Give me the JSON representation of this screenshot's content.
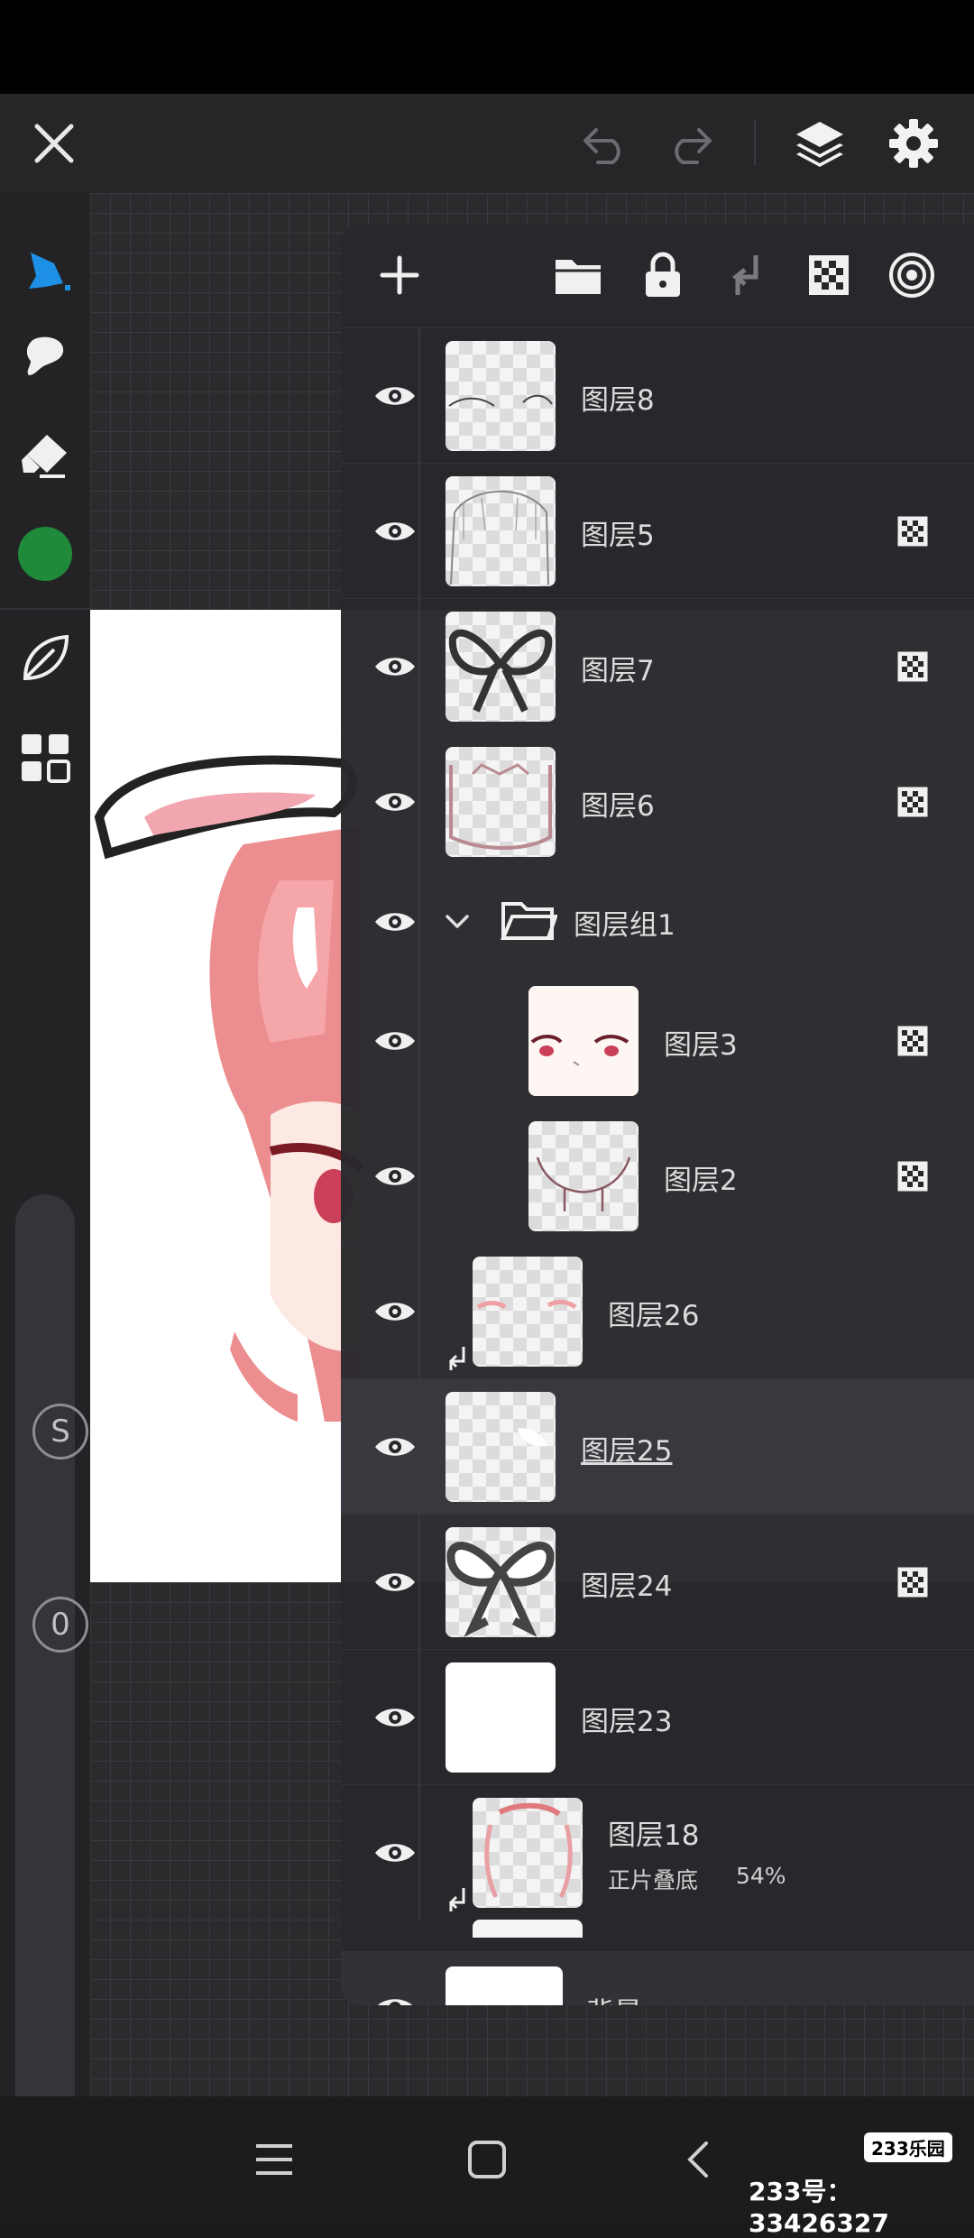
{
  "toolbar": {
    "close": "close-icon",
    "undo": "undo-icon",
    "redo": "redo-icon",
    "layers": "layers-icon",
    "settings": "gear-icon"
  },
  "colors": {
    "accent": "#1e90e6",
    "current_color": "#1e8a3a",
    "panel_bg": "#28282c",
    "selected_row": "#3a3a40"
  },
  "left_tools": [
    "brush-icon",
    "smudge-icon",
    "eraser-icon",
    "color-swatch",
    "leaf-icon",
    "gallery-icon"
  ],
  "sliders": {
    "size_label": "S",
    "opacity_label": "0"
  },
  "panel": {
    "header_buttons": [
      "add-layer",
      "folder",
      "lock",
      "merge-down",
      "alpha-lock",
      "reference"
    ],
    "layers": [
      {
        "name": "图层8",
        "alpha_lock": false
      },
      {
        "name": "图层5",
        "alpha_lock": true
      },
      {
        "name": "图层7",
        "alpha_lock": true
      },
      {
        "name": "图层6",
        "alpha_lock": true
      },
      {
        "name": "图层组1",
        "type": "group"
      },
      {
        "name": "图层3",
        "alpha_lock": true,
        "indent": true
      },
      {
        "name": "图层2",
        "alpha_lock": true,
        "indent": true
      },
      {
        "name": "图层26",
        "clipped": true
      },
      {
        "name": "图层25",
        "selected": true
      },
      {
        "name": "图层24",
        "alpha_lock": true
      },
      {
        "name": "图层23"
      },
      {
        "name": "图层18",
        "clipped": true,
        "blend": "正片叠底",
        "opacity": "54%"
      },
      {
        "name": "背景"
      }
    ]
  },
  "navbar": {
    "menu": "menu-icon",
    "home": "home-icon",
    "back": "back-icon"
  },
  "watermark": {
    "badge": "233乐园",
    "text": "233号：33426327"
  }
}
